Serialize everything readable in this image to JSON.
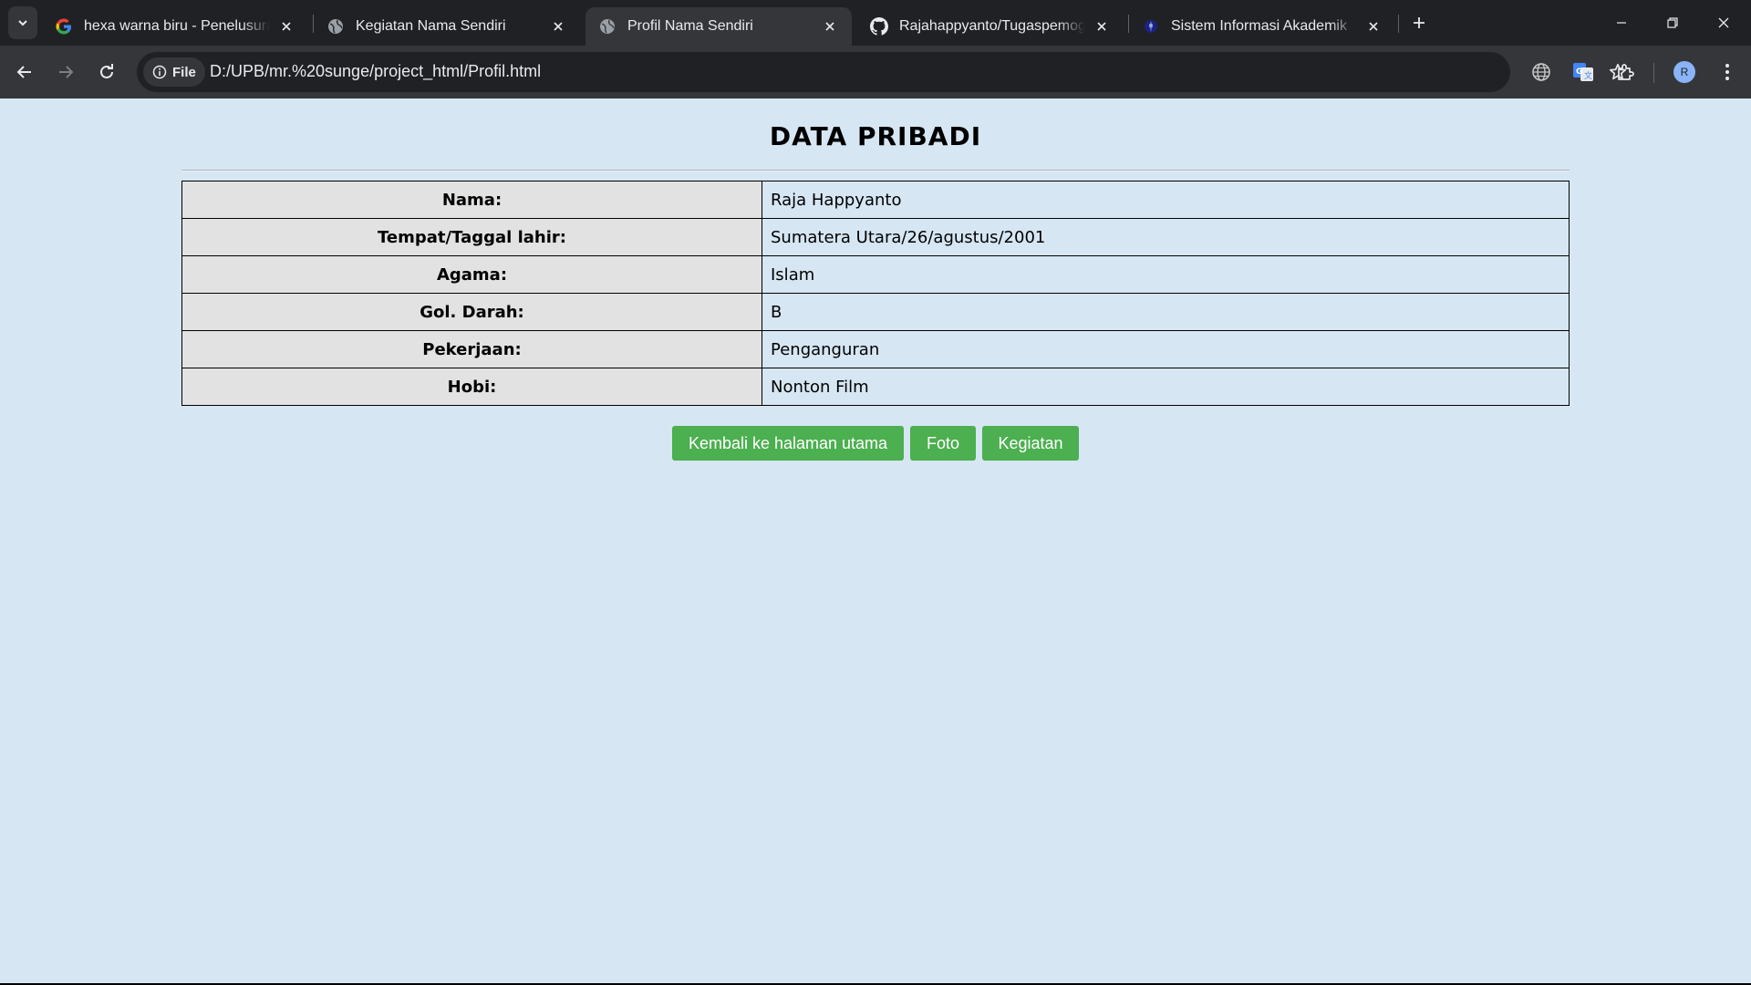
{
  "browser": {
    "tabs": [
      {
        "title": "hexa warna biru - Penelusuran Google",
        "icon": "google-icon",
        "active": false
      },
      {
        "title": "Kegiatan Nama Sendiri",
        "icon": "globe-icon",
        "active": false
      },
      {
        "title": "Profil Nama Sendiri",
        "icon": "globe-icon",
        "active": true
      },
      {
        "title": "Rajahappyanto/Tugaspemograman",
        "icon": "github-icon",
        "active": false
      },
      {
        "title": "Sistem Informasi Akademik",
        "icon": "siakad-icon",
        "active": false
      }
    ],
    "address": {
      "chip_label": "File",
      "url": "D:/UPB/mr.%20sunge/project_html/Profil.html"
    },
    "profile_initial": "R"
  },
  "page": {
    "title": "DATA PRIBADI",
    "rows": [
      {
        "label": "Nama:",
        "value": "Raja Happyanto"
      },
      {
        "label": "Tempat/Taggal lahir:",
        "value": "Sumatera Utara/26/agustus/2001"
      },
      {
        "label": "Agama:",
        "value": "Islam"
      },
      {
        "label": "Gol. Darah:",
        "value": "B"
      },
      {
        "label": "Pekerjaan:",
        "value": "Penganguran"
      },
      {
        "label": "Hobi:",
        "value": "Nonton Film"
      }
    ],
    "buttons": {
      "home": "Kembali ke halaman utama",
      "photo": "Foto",
      "activity": "Kegiatan"
    }
  },
  "colors": {
    "page_background": "#d6e6f3",
    "label_cell": "#e2e2e2",
    "button_green": "#4caf50"
  }
}
